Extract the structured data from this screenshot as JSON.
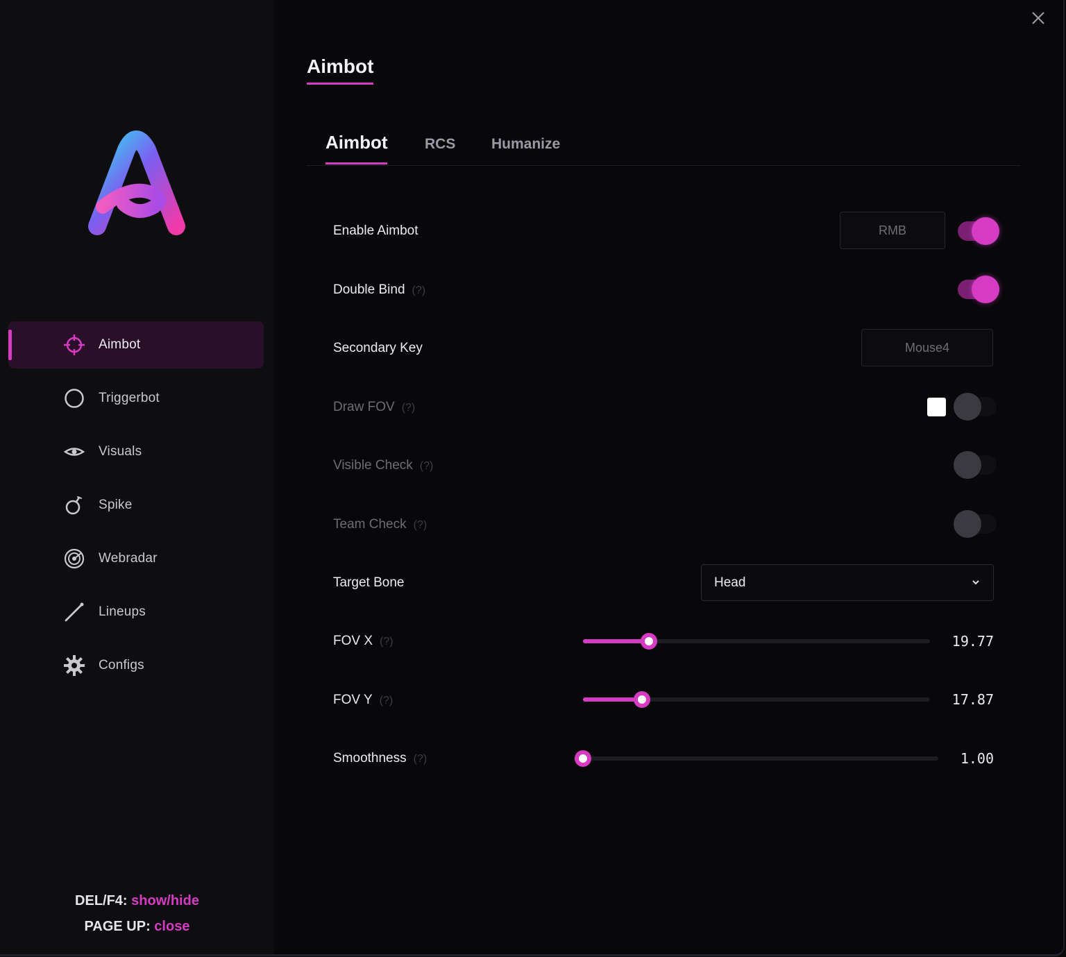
{
  "colors": {
    "accent": "#d63bc4",
    "background": "#08080a",
    "sidebar": "#0e0e10",
    "active_nav": "#2a0f29"
  },
  "sidebar": {
    "items": [
      {
        "label": "Aimbot",
        "icon": "crosshair-icon",
        "active": true
      },
      {
        "label": "Triggerbot",
        "icon": "circle-icon",
        "active": false
      },
      {
        "label": "Visuals",
        "icon": "eye-icon",
        "active": false
      },
      {
        "label": "Spike",
        "icon": "bomb-icon",
        "active": false
      },
      {
        "label": "Webradar",
        "icon": "radar-icon",
        "active": false
      },
      {
        "label": "Lineups",
        "icon": "line-icon",
        "active": false
      },
      {
        "label": "Configs",
        "icon": "gear-icon",
        "active": false
      }
    ],
    "hints": [
      {
        "key": "DEL/F4:",
        "action": "show/hide"
      },
      {
        "key": "PAGE UP:",
        "action": "close"
      }
    ]
  },
  "header": {
    "title": "Aimbot"
  },
  "tabs": [
    {
      "label": "Aimbot",
      "active": true
    },
    {
      "label": "RCS",
      "active": false
    },
    {
      "label": "Humanize",
      "active": false
    }
  ],
  "settings": {
    "enable_aimbot": {
      "label": "Enable Aimbot",
      "key": "RMB",
      "enabled": true
    },
    "double_bind": {
      "label": "Double Bind",
      "help": "(?)",
      "enabled": true
    },
    "secondary_key": {
      "label": "Secondary Key",
      "key": "Mouse4"
    },
    "draw_fov": {
      "label": "Draw FOV",
      "help": "(?)",
      "enabled": false,
      "color": "#ffffff"
    },
    "visible_check": {
      "label": "Visible Check",
      "help": "(?)",
      "enabled": false
    },
    "team_check": {
      "label": "Team Check",
      "help": "(?)",
      "enabled": false
    },
    "target_bone": {
      "label": "Target Bone",
      "value": "Head"
    },
    "fov_x": {
      "label": "FOV X",
      "help": "(?)",
      "value": "19.77",
      "fraction": 0.19
    },
    "fov_y": {
      "label": "FOV Y",
      "help": "(?)",
      "value": "17.87",
      "fraction": 0.17
    },
    "smoothness": {
      "label": "Smoothness",
      "help": "(?)",
      "value": "1.00",
      "fraction": 0.0
    }
  }
}
